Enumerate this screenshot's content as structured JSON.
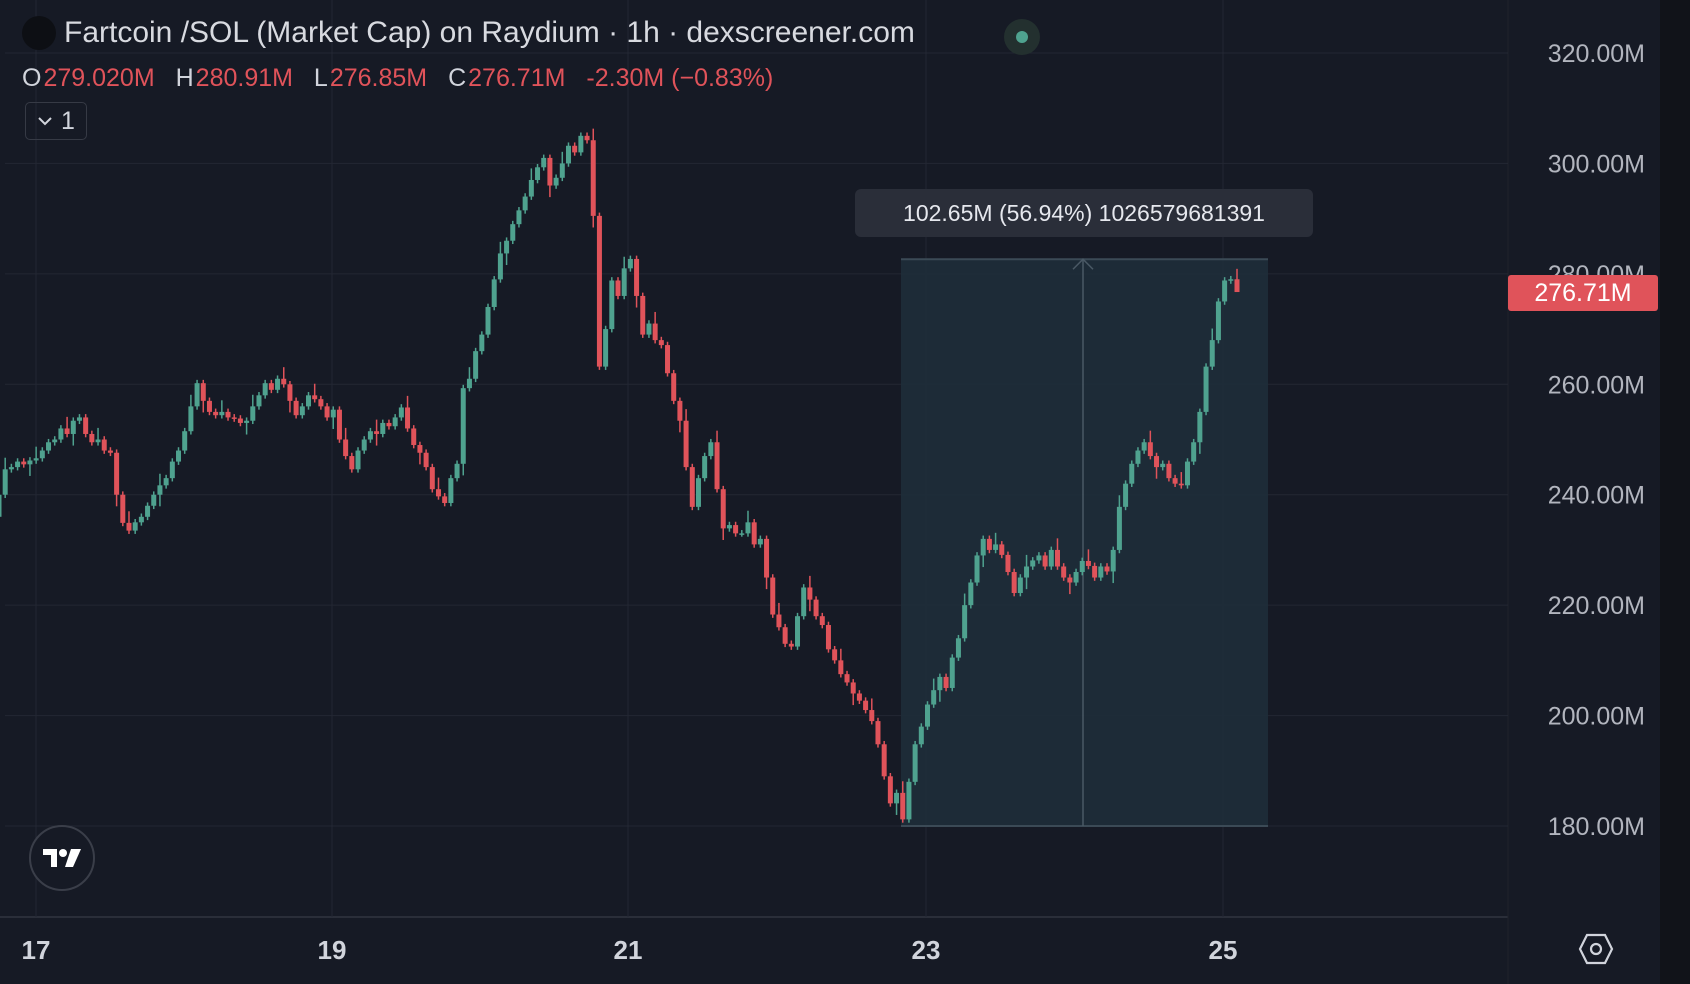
{
  "header": {
    "title": "Fartcoin /SOL (Market Cap) on Raydium · 1h · dexscreener.com",
    "ohlc": {
      "o_label": "O",
      "o": "279.020M",
      "h_label": "H",
      "h": "280.91M",
      "l_label": "L",
      "l": "276.85M",
      "c_label": "C",
      "c": "276.71M",
      "change": "-2.30M (−0.83%)"
    },
    "collapse_count": "1"
  },
  "measure_tooltip": "102.65M (56.94%) 1026579681391",
  "last_price_label": "276.71M",
  "colors": {
    "up": "#4fa28f",
    "down": "#e0535a",
    "background": "#161a25",
    "measure": "#1e2d3a"
  },
  "chart_data": {
    "type": "candlestick",
    "title": "Fartcoin /SOL (Market Cap) on Raydium · 1h",
    "interval": "1h",
    "ylim": [
      180,
      320
    ],
    "y_unit": "M",
    "y_ticks": [
      "320.00M",
      "300.00M",
      "280.00M",
      "260.00M",
      "240.00M",
      "220.00M",
      "200.00M",
      "180.00M"
    ],
    "y_tick_values": [
      320,
      300,
      280,
      260,
      240,
      220,
      200,
      180
    ],
    "x_ticks": [
      "17",
      "19",
      "21",
      "23",
      "25"
    ],
    "grid": true,
    "closes": [
      240.7,
      236,
      233.9,
      232,
      234,
      233,
      231.5,
      234,
      236,
      240,
      244.6,
      245,
      246,
      245.5,
      246.2,
      246.6,
      248,
      249.5,
      250,
      252,
      251,
      253.4,
      254,
      251,
      249.5,
      250,
      248,
      247.6,
      240,
      234.9,
      233.5,
      235,
      236,
      238,
      240,
      241.7,
      243,
      246,
      248,
      251.5,
      256,
      260.2,
      257,
      255,
      254.4,
      255,
      254,
      253.8,
      253,
      253.4,
      256,
      258,
      260.2,
      259,
      261,
      260,
      257,
      254.4,
      256,
      258,
      257.3,
      256,
      254,
      255.4,
      250,
      247,
      244.6,
      248,
      250,
      251.5,
      251,
      253,
      252.4,
      254,
      255.8,
      252,
      249,
      247.6,
      245,
      241,
      239.7,
      238.5,
      243,
      245.6,
      259.3,
      261,
      266,
      269,
      274,
      279,
      283.7,
      286,
      289,
      291.5,
      294,
      297,
      299.3,
      301,
      296,
      297.4,
      300,
      303.2,
      302,
      305,
      304.2,
      290.5,
      263.2,
      270,
      278.8,
      276,
      281,
      282.7,
      276,
      269,
      271,
      268,
      267.1,
      262,
      257,
      253.4,
      245,
      237.8,
      243,
      247,
      249.5,
      241,
      233.9,
      234.5,
      233,
      233,
      235,
      231,
      232,
      225,
      218.3,
      216,
      213,
      212.5,
      218,
      223.2,
      221,
      218,
      216.4,
      212,
      210,
      207.5,
      206,
      204,
      202.7,
      201,
      199,
      194.8,
      189,
      184.1,
      186,
      181.2,
      188,
      194.8,
      198,
      202,
      204.6,
      207,
      205,
      210.5,
      214,
      220,
      224.1,
      229,
      232,
      230,
      231,
      229.1,
      226,
      222.2,
      225,
      227,
      228.1,
      229,
      227,
      230,
      227,
      225,
      224.1,
      226,
      228,
      227.1,
      225,
      227,
      226.1,
      230,
      237.8,
      242,
      245.6,
      248,
      249.5,
      247,
      245,
      245.6,
      243,
      242,
      241.7,
      246,
      249.5,
      255,
      263.2,
      268,
      275,
      278.8,
      279.02,
      276.71
    ],
    "last": {
      "open": 279.02,
      "high": 280.91,
      "low": 276.85,
      "close": 276.71
    },
    "measure": {
      "low": 180.0,
      "high": 282.65,
      "change": 102.65,
      "change_pct": 56.94
    }
  }
}
